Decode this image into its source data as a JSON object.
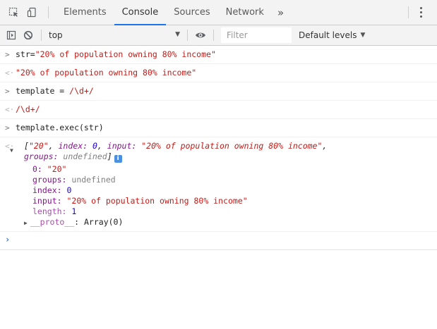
{
  "tabs": {
    "items": [
      {
        "label": "Elements"
      },
      {
        "label": "Console"
      },
      {
        "label": "Sources"
      },
      {
        "label": "Network"
      }
    ],
    "more": "»"
  },
  "toolbar": {
    "context": "top",
    "filter_placeholder": "Filter",
    "levels": "Default levels"
  },
  "console": {
    "line1_input_prefix": "str=",
    "line1_input_string": "\"20% of population owning 80% income\"",
    "line1_result": "\"20% of population owning 80% income\"",
    "line2_input_prefix": "template = ",
    "line2_input_regex": "/\\d+/",
    "line2_result": "/\\d+/",
    "line3_input": "template.exec(str)",
    "result_head_open": "[",
    "result_head_first": "\"20\"",
    "result_head_index_key": "index: ",
    "result_head_index_val": "0",
    "result_head_input_key": "input: ",
    "result_head_input_val": "\"20% of population owning 80% income\"",
    "result_head_trailing": ",",
    "result_head_groups_key": "groups: ",
    "result_head_groups_val": "undefined",
    "result_head_close": "]",
    "info_badge": "i",
    "tree": {
      "item0_key": "0: ",
      "item0_val": "\"20\"",
      "groups_key": "groups: ",
      "groups_val": "undefined",
      "index_key": "index: ",
      "index_val": "0",
      "input_key": "input: ",
      "input_val": "\"20% of population owning 80% income\"",
      "length_key": "length: ",
      "length_val": "1",
      "proto_key": "__proto__",
      "proto_sep": ": ",
      "proto_val": "Array(0)"
    }
  }
}
